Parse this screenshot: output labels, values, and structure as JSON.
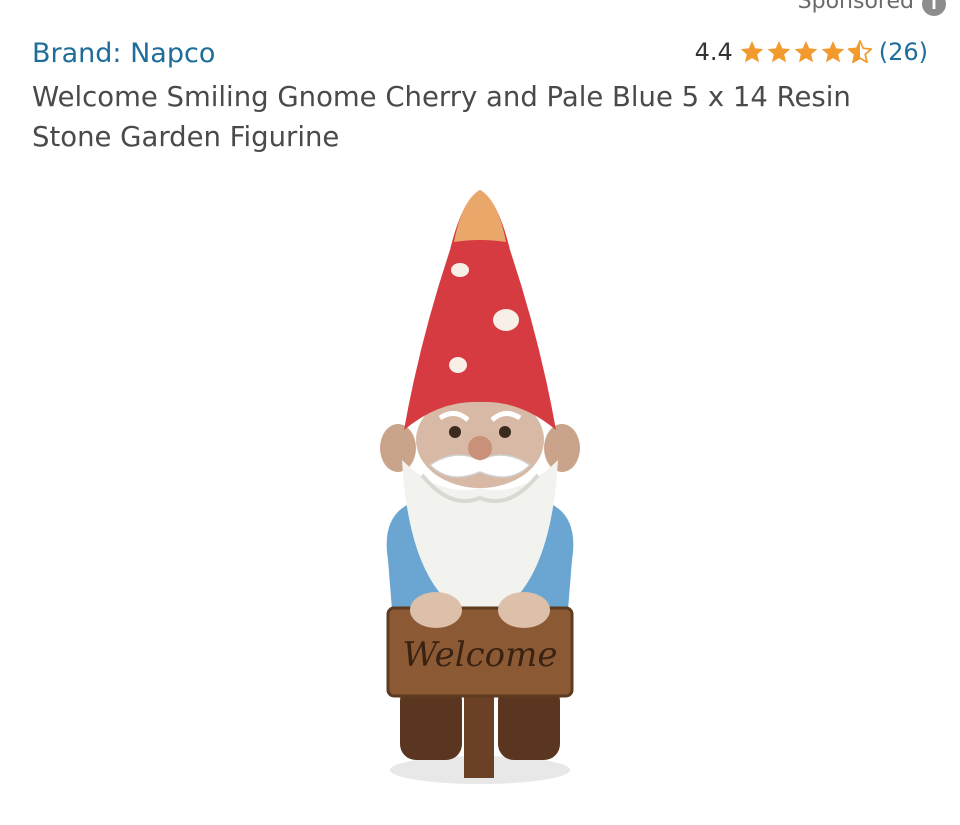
{
  "sponsored": {
    "label": "Sponsored",
    "info_icon": "info-icon"
  },
  "product": {
    "brand": "Brand: Napco",
    "rating": "4.4",
    "stars": {
      "value": 4.4,
      "max": 5
    },
    "review_count": "(26)",
    "title": "Welcome Smiling Gnome Cherry and Pale Blue 5 x 14 Resin Stone Garden Figurine",
    "image": {
      "alt": "garden-gnome-figurine",
      "sign_text": "Welcome"
    }
  },
  "colors": {
    "link": "#1f6d9a",
    "star": "#f29a2e",
    "text": "#4a4a4a"
  }
}
